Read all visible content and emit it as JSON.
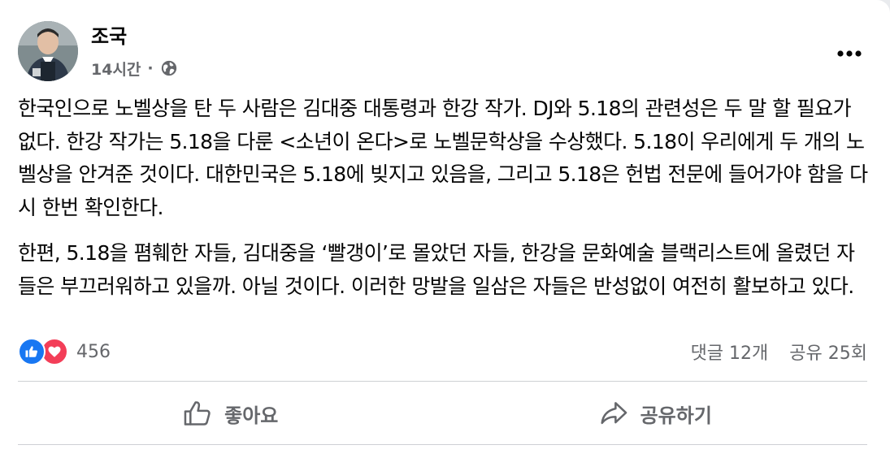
{
  "post": {
    "author": "조국",
    "time": "14시간",
    "separator": "·",
    "audience_icon": "globe-icon",
    "more_icon": "more-horizontal-icon",
    "paragraphs": [
      "한국인으로 노벨상을 탄 두 사람은 김대중 대통령과 한강 작가. DJ와 5.18의 관련성은 두 말 할 필요가 없다. 한강 작가는 5.18을 다룬 <소년이 온다>로 노벨문학상을 수상했다. 5.18이 우리에게 두 개의 노벨상을 안겨준 것이다. 대한민국은 5.18에 빚지고 있음을, 그리고 5.18은 헌법 전문에 들어가야 함을 다시 한번 확인한다.",
      "한편, 5.18을 폄훼한 자들, 김대중을 ‘빨갱이’로 몰았던 자들, 한강을 문화예술 블랙리스트에 올렸던 자들은 부끄러워하고 있을까. 아닐 것이다. 이러한 망발을 일삼은 자들은 반성없이 여전히 활보하고 있다."
    ]
  },
  "stats": {
    "reaction_icons": [
      "like-icon",
      "love-icon"
    ],
    "reaction_count": "456",
    "comments": "댓글 12개",
    "shares": "공유 25회"
  },
  "actions": {
    "like_label": "좋아요",
    "share_label": "공유하기"
  },
  "colors": {
    "like_blue": "#1877f2",
    "love_red": "#f33e58",
    "secondary_text": "#65676b",
    "divider": "#ced0d4"
  }
}
